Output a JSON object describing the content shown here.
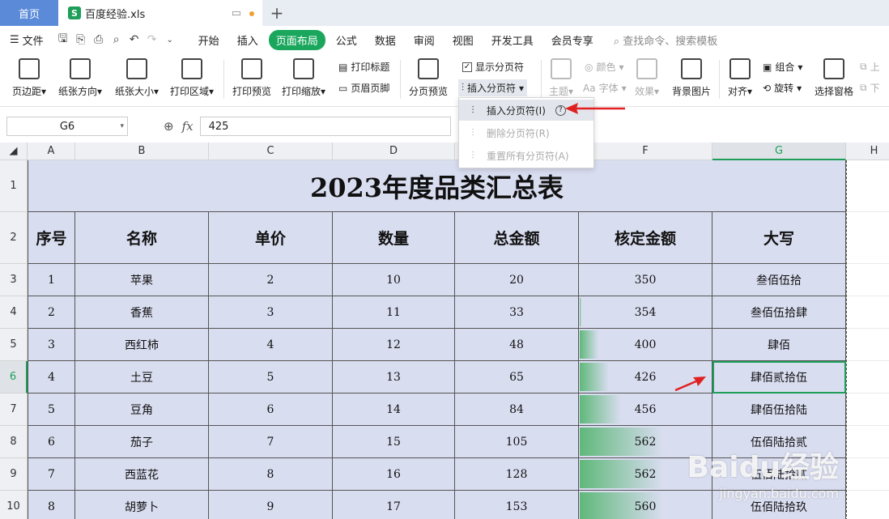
{
  "tabs": {
    "home": "首页",
    "file": "百度经验.xls",
    "add": "+"
  },
  "menu": {
    "file": "文件",
    "items": [
      "开始",
      "插入",
      "页面布局",
      "公式",
      "数据",
      "审阅",
      "视图",
      "开发工具",
      "会员专享"
    ],
    "active": "页面布局",
    "search": "查找命令、搜索模板"
  },
  "ribbon": {
    "margin": "页边距",
    "orientation": "纸张方向",
    "size": "纸张大小",
    "print_area": "打印区域",
    "print_preview": "打印预览",
    "print_scale": "打印缩放",
    "print_titles": "打印标题",
    "header_footer": "页眉页脚",
    "page_break_preview": "分页预览",
    "show_breaks": "显示分页符",
    "insert_break": "插入分页符",
    "theme": "主题",
    "colors": "颜色",
    "fonts": "字体",
    "effects": "效果",
    "background": "背景图片",
    "align": "对齐",
    "group": "组合",
    "rotate": "旋转",
    "selection_pane": "选择窗格",
    "up": "上",
    "down": "下"
  },
  "dropdown": {
    "insert": "插入分页符(I)",
    "delete": "删除分页符(R)",
    "reset": "重置所有分页符(A)"
  },
  "formula_bar": {
    "cell_ref": "G6",
    "fx": "fx",
    "value": "425"
  },
  "columns": [
    "A",
    "B",
    "C",
    "D",
    "E",
    "F",
    "G",
    "H"
  ],
  "row_numbers": [
    "1",
    "2",
    "3",
    "4",
    "5",
    "6",
    "7",
    "8",
    "9",
    "10"
  ],
  "sheet": {
    "title": "2023年度品类汇总表",
    "headers": [
      "序号",
      "名称",
      "单价",
      "数量",
      "总金额",
      "核定金额",
      "大写"
    ],
    "rows": [
      {
        "no": "1",
        "name": "苹果",
        "price": "2",
        "qty": "10",
        "total": "20",
        "approved": "350",
        "approved_bar": 0,
        "upper": "叁佰伍拾"
      },
      {
        "no": "2",
        "name": "香蕉",
        "price": "3",
        "qty": "11",
        "total": "33",
        "approved": "354",
        "approved_bar": 0.01,
        "upper": "叁佰伍拾肆"
      },
      {
        "no": "3",
        "name": "西红柿",
        "price": "4",
        "qty": "12",
        "total": "48",
        "approved": "400",
        "approved_bar": 0.14,
        "upper": "肆佰"
      },
      {
        "no": "4",
        "name": "土豆",
        "price": "5",
        "qty": "13",
        "total": "65",
        "approved": "426",
        "approved_bar": 0.22,
        "upper": "肆佰贰拾伍"
      },
      {
        "no": "5",
        "name": "豆角",
        "price": "6",
        "qty": "14",
        "total": "84",
        "approved": "456",
        "approved_bar": 0.31,
        "upper": "肆佰伍拾陆"
      },
      {
        "no": "6",
        "name": "茄子",
        "price": "7",
        "qty": "15",
        "total": "105",
        "approved": "562",
        "approved_bar": 0.63,
        "upper": "伍佰陆拾贰"
      },
      {
        "no": "7",
        "name": "西蓝花",
        "price": "8",
        "qty": "16",
        "total": "128",
        "approved": "562",
        "approved_bar": 0.63,
        "upper": "伍佰陆拾贰"
      },
      {
        "no": "8",
        "name": "胡萝卜",
        "price": "9",
        "qty": "17",
        "total": "153",
        "approved": "560",
        "approved_bar": 0.63,
        "upper": "伍佰陆拾玖"
      }
    ],
    "selected_row": 6,
    "selected_col": "G"
  },
  "watermark": {
    "brand": "Baidu经验",
    "url": "jingyan.baidu.com"
  },
  "colors": {
    "accent": "#1aa75d",
    "cell_bg": "#d9ddf0",
    "arrow": "#e02020"
  }
}
